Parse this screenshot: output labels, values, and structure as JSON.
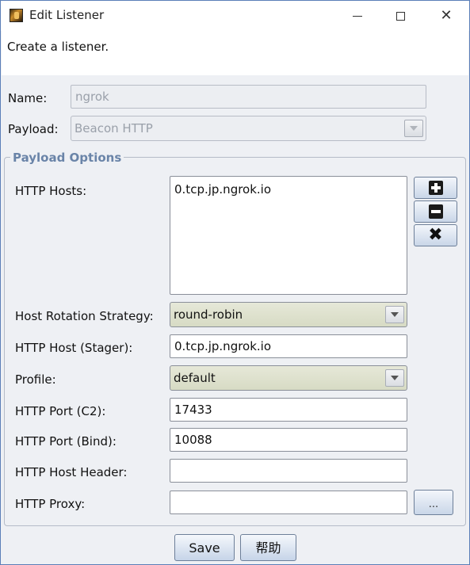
{
  "window": {
    "title": "Edit Listener",
    "minimize_glyph": "",
    "maximize_glyph": "",
    "close_glyph": "✕"
  },
  "description": "Create a listener.",
  "form": {
    "name_label": "Name:",
    "name_value": "ngrok",
    "payload_label": "Payload:",
    "payload_value": "Beacon HTTP"
  },
  "payload_options": {
    "legend": "Payload Options",
    "http_hosts_label": "HTTP Hosts:",
    "http_hosts": [
      "0.tcp.jp.ngrok.io"
    ],
    "add_icon": "plus-icon",
    "remove_icon": "minus-icon",
    "clear_icon": "x-icon",
    "rotation_label": "Host Rotation Strategy:",
    "rotation_value": "round-robin",
    "stager_label": "HTTP Host (Stager):",
    "stager_value": "0.tcp.jp.ngrok.io",
    "profile_label": "Profile:",
    "profile_value": "default",
    "port_c2_label": "HTTP Port (C2):",
    "port_c2_value": "17433",
    "port_bind_label": "HTTP Port (Bind):",
    "port_bind_value": "10088",
    "host_header_label": "HTTP Host Header:",
    "host_header_value": "",
    "proxy_label": "HTTP Proxy:",
    "proxy_value": "",
    "proxy_button": "..."
  },
  "buttons": {
    "save": "Save",
    "help": "帮助"
  },
  "colors": {
    "legend": "#6a84a8",
    "combo_bg": "#dfe2cc",
    "button_gradient_end": "#c6d4e8"
  }
}
